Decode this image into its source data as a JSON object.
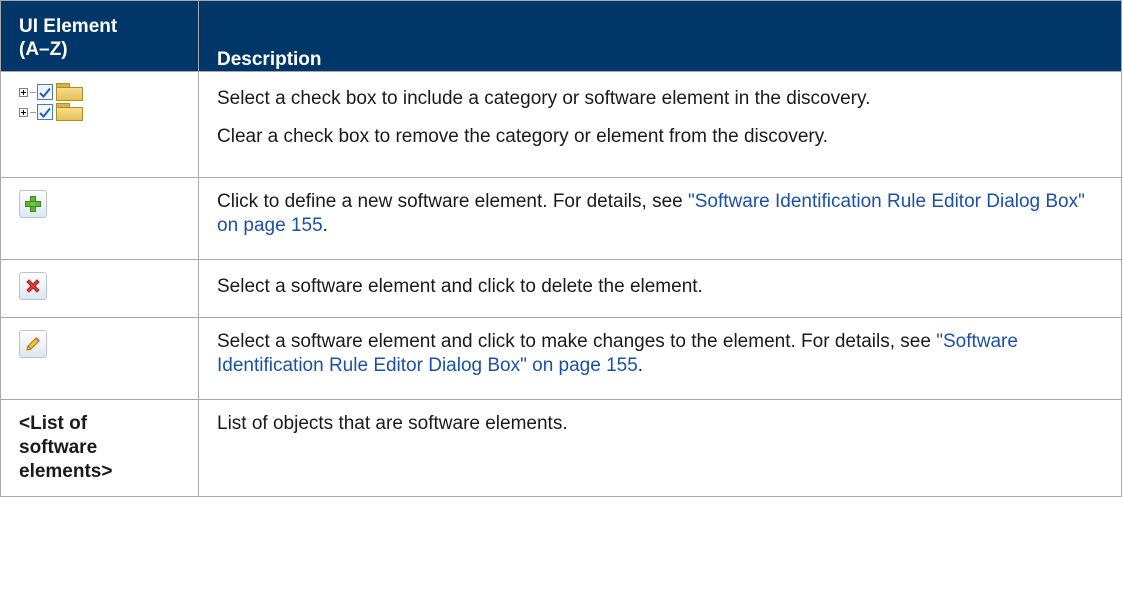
{
  "header": {
    "col1_line1": "UI Element",
    "col1_line2": "(A–Z)",
    "col2": "Description"
  },
  "rows": [
    {
      "icon": "tree-checkbox-folder-icon",
      "p1": "Select a check box to include a category or software element in the discovery.",
      "p2": "Clear a check box to remove the category or element from the discovery."
    },
    {
      "icon": "add-icon",
      "text": "Click to define a new software element. For details, see ",
      "link": "\"Software Identification Rule Editor Dialog Box\" on page 155",
      "after": "."
    },
    {
      "icon": "delete-icon",
      "text": "Select a software element and click to delete the element."
    },
    {
      "icon": "edit-icon",
      "text": "Select a software element and click to make changes to the element. For details, see ",
      "link": "\"Software Identification Rule Editor Dialog Box\" on page 155",
      "after": "."
    },
    {
      "label_line1": "<List of",
      "label_line2": "software",
      "label_line3": "elements>",
      "text": "List of objects that are software elements."
    }
  ],
  "colors": {
    "header_bg": "#003768",
    "link": "#1a50a6",
    "border": "#a8a8a8"
  }
}
